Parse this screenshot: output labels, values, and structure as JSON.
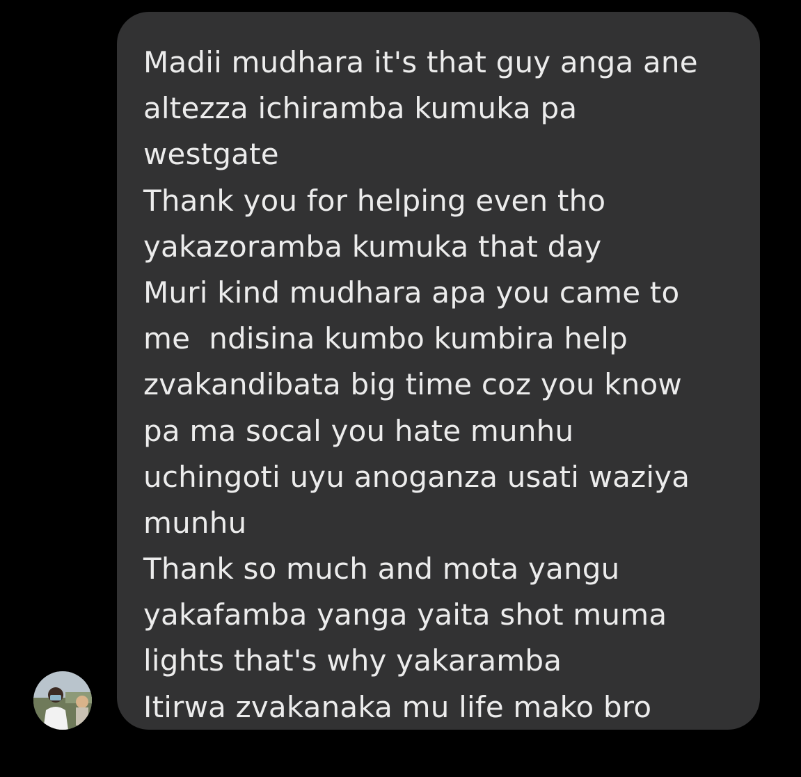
{
  "message": {
    "lines": [
      "Madii mudhara it's that guy anga ane",
      "altezza ichiramba kumuka pa",
      "westgate",
      "Thank you for helping even tho",
      "yakazoramba kumuka that day",
      "Muri kind mudhara apa you came to",
      "me  ndisina kumbo kumbira help",
      "zvakandibata big time coz you know",
      "pa ma socal you hate munhu",
      "uchingoti uyu anoganza usati waziya",
      "munhu",
      "Thank so much and mota yangu",
      "yakafamba yanga yaita shot muma",
      "lights that's why yakaramba",
      "Itirwa zvakanaka mu life mako bro"
    ]
  },
  "sender": {
    "avatar_icon": "profile-photo"
  },
  "colors": {
    "background": "#000000",
    "bubble": "#323233",
    "text": "#ececec"
  }
}
